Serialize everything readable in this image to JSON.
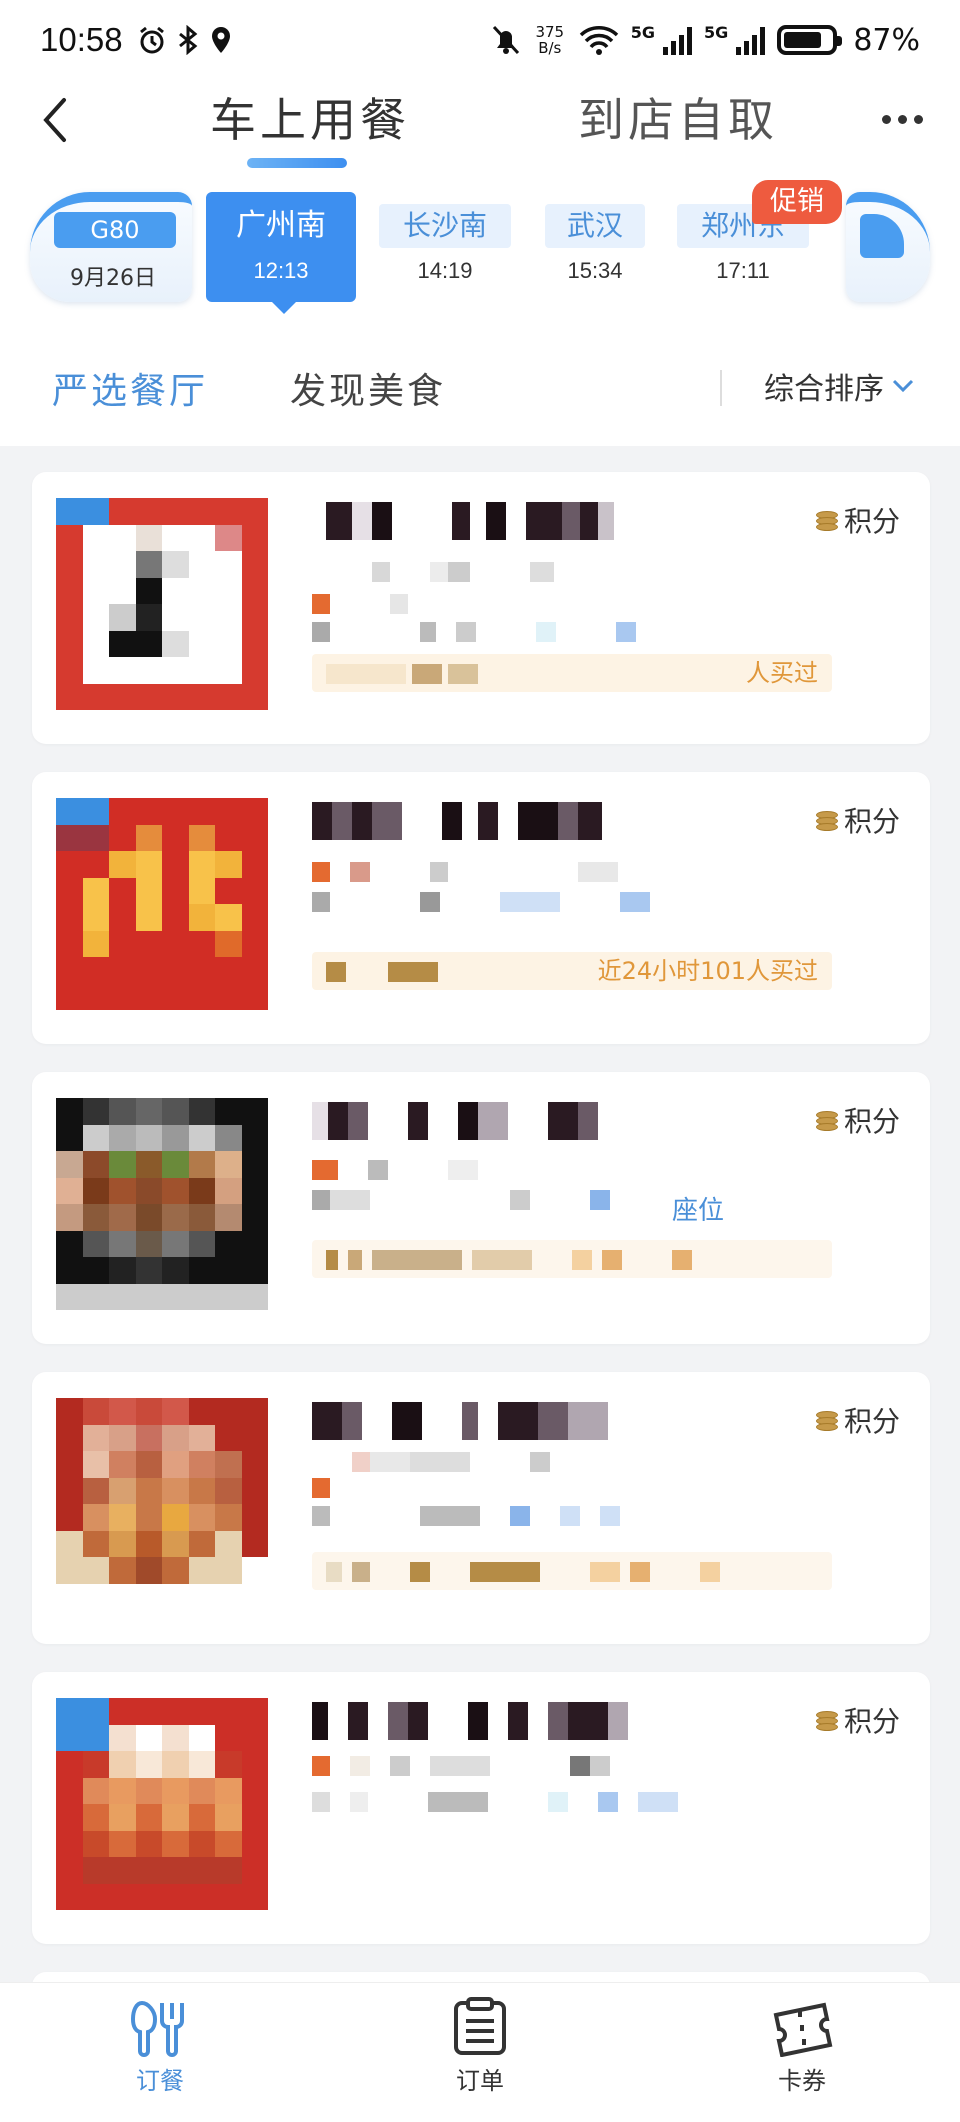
{
  "status_bar": {
    "time": "10:58",
    "net_speed_value": "375",
    "net_speed_unit": "B/s",
    "network_1": "5G",
    "network_2": "5G",
    "battery": "87%"
  },
  "header": {
    "tabs": [
      {
        "label": "车上用餐",
        "active": true
      },
      {
        "label": "到店自取",
        "active": false
      }
    ]
  },
  "train": {
    "number": "G80",
    "date": "9月26日",
    "stations": [
      {
        "name": "广州南",
        "time": "12:13",
        "active": true
      },
      {
        "name": "长沙南",
        "time": "14:19",
        "active": false
      },
      {
        "name": "武汉",
        "time": "15:34",
        "active": false
      },
      {
        "name": "郑州东",
        "time": "17:11",
        "active": false
      }
    ],
    "promo_badge": "促销"
  },
  "filters": {
    "tabs": [
      {
        "label": "严选餐厅",
        "active": true
      },
      {
        "label": "发现美食",
        "active": false
      }
    ],
    "sort_label": "综合排序"
  },
  "cards": [
    {
      "points_label": "积分",
      "sales_text": "人买过",
      "tag_prefix": "",
      "accent": "#d63a2f"
    },
    {
      "points_label": "积分",
      "sales_text": "近24小时101人买过",
      "tag_prefix": "",
      "accent": "#d63a2f",
      "extra_tail": "¥49"
    },
    {
      "points_label": "积分",
      "sales_text": "",
      "tag_prefix": "",
      "accent": "#222222",
      "extra_blue": "座位"
    },
    {
      "points_label": "积分",
      "sales_text": "",
      "tag_prefix": "",
      "accent": "#b32a20"
    },
    {
      "points_label": "积分",
      "sales_text": "",
      "tag_prefix": "",
      "accent": "#cc2f27"
    }
  ],
  "bottom_nav": [
    {
      "label": "订餐",
      "icon": "fork-knife-icon",
      "active": true
    },
    {
      "label": "订单",
      "icon": "clipboard-icon",
      "active": false
    },
    {
      "label": "卡券",
      "icon": "ticket-icon",
      "active": false
    }
  ],
  "colors": {
    "accent_blue": "#3d8ff0",
    "promo_red": "#ee5b3f",
    "tag_bg": "#fdf3e4",
    "tag_text": "#e0973a"
  }
}
